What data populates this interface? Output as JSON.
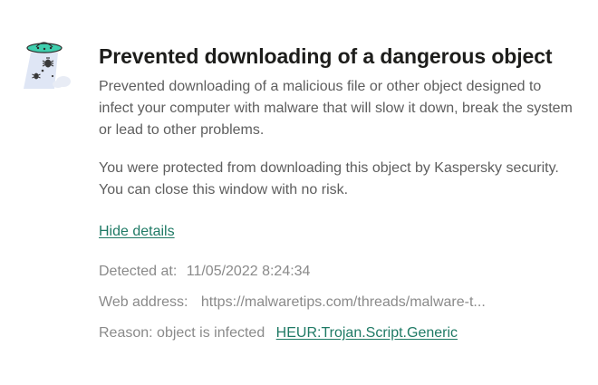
{
  "notification": {
    "title": "Prevented downloading of a dangerous object",
    "description": "Prevented downloading of a malicious file or other object designed to infect your computer with malware that will slow it down, break the system or lead to other problems.",
    "protection_note": "You were protected from downloading this object by Kaspersky security. You can close this window with no risk.",
    "hide_details_label": "Hide details"
  },
  "details": {
    "detected_label": "Detected at:",
    "detected_value": "11/05/2022 8:24:34",
    "web_address_label": "Web address:",
    "web_address_value": "https://malwaretips.com/threads/malware-t...",
    "reason_label": "Reason: object is infected",
    "reason_threat": "HEUR:Trojan.Script.Generic"
  },
  "icon": {
    "name": "ufo-malware-icon",
    "accent_color": "#3fcfae"
  },
  "colors": {
    "link": "#1f7a65",
    "title": "#1d1d1b",
    "body_text": "#5e5e5e",
    "muted_text": "#8a8a8a"
  }
}
